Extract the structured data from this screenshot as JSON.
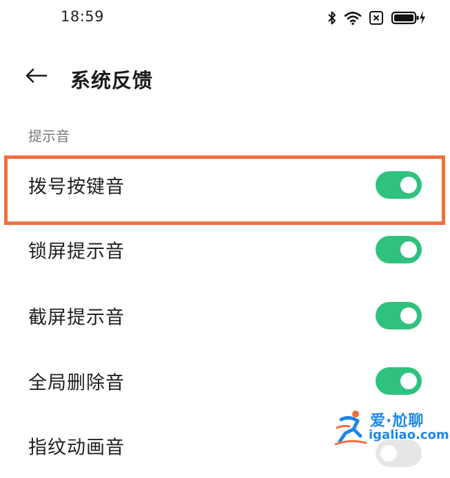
{
  "status_bar": {
    "time": "18:59",
    "icons": [
      "bluetooth-icon",
      "wifi-icon",
      "sim-disabled-icon",
      "battery-charging-icon"
    ]
  },
  "header": {
    "back_icon": "arrow-left-icon",
    "title": "系统反馈"
  },
  "section": {
    "label": "提示音"
  },
  "rows": [
    {
      "label": "拨号按键音",
      "enabled": true
    },
    {
      "label": "锁屏提示音",
      "enabled": true
    },
    {
      "label": "截屏提示音",
      "enabled": true
    },
    {
      "label": "全局删除音",
      "enabled": true
    },
    {
      "label": "指纹动画音",
      "enabled": false
    }
  ],
  "watermark": {
    "name": "爱·尬聊",
    "url": "igaliao.com"
  },
  "colors": {
    "toggle_on": "#2ec27e",
    "highlight": "#f26d3d",
    "watermark": "#1e88e5"
  }
}
